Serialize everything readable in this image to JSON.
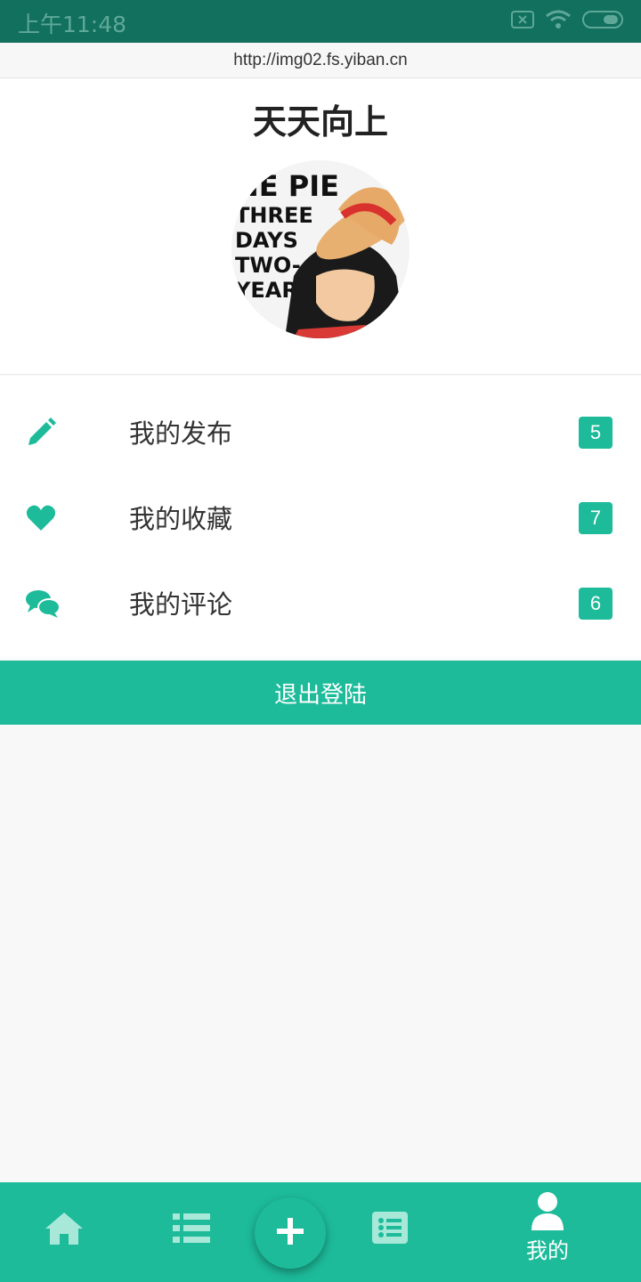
{
  "status_bar": {
    "time": "上午11:48"
  },
  "browser": {
    "url": "http://img02.fs.yiban.cn"
  },
  "profile": {
    "name": "天天向上",
    "avatar_text": [
      "NE PIE",
      "THREE",
      "DAYS",
      "TWO-",
      "YEARS"
    ]
  },
  "menu": [
    {
      "label": "我的发布",
      "icon": "pencil-icon",
      "count": "5"
    },
    {
      "label": "我的收藏",
      "icon": "heart-icon",
      "count": "7"
    },
    {
      "label": "我的评论",
      "icon": "comments-icon",
      "count": "6"
    }
  ],
  "logout_label": "退出登陆",
  "bottom_nav": {
    "items": [
      {
        "icon": "home-icon"
      },
      {
        "icon": "list-icon"
      },
      {
        "icon": "plus-icon"
      },
      {
        "icon": "list-alt-icon"
      },
      {
        "icon": "user-icon",
        "label": "我的"
      }
    ],
    "active_label": "我的"
  },
  "colors": {
    "accent": "#1dbb9a",
    "status_bar": "#11705e"
  }
}
